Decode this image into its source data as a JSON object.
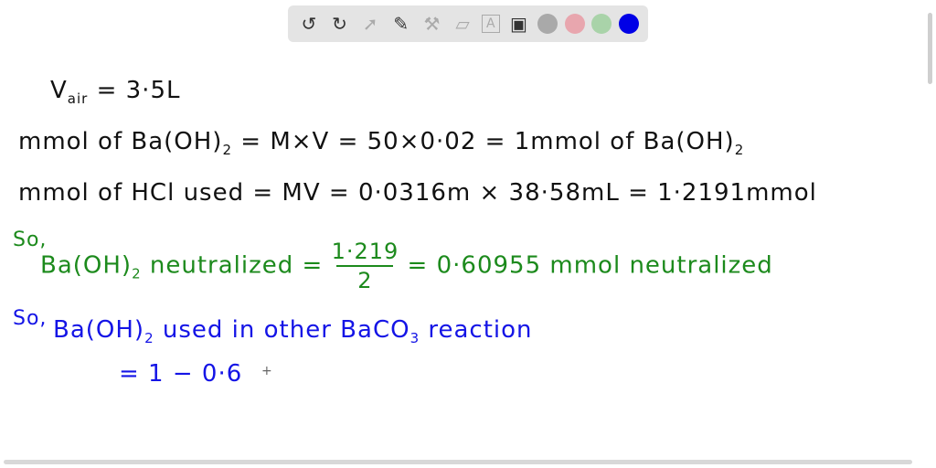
{
  "toolbar": {
    "tools": [
      {
        "icon": "undo-icon",
        "glyph": "↺"
      },
      {
        "icon": "redo-icon",
        "glyph": "↻"
      },
      {
        "icon": "select-cursor-icon",
        "glyph": "➚"
      },
      {
        "icon": "pencil-icon",
        "glyph": "✎"
      },
      {
        "icon": "tools-icon",
        "glyph": "⚒"
      },
      {
        "icon": "eraser-icon",
        "glyph": "▱"
      },
      {
        "icon": "text-box-icon",
        "glyph": "A"
      },
      {
        "icon": "image-icon",
        "glyph": "▣"
      }
    ],
    "colors": [
      "#a9a9a9",
      "#e8a6ae",
      "#a9d3a9",
      "#0000e6"
    ]
  },
  "notes": {
    "line1": {
      "lhs": "V",
      "sub": "air",
      "rhs": " = 3·5L"
    },
    "line2": {
      "a": "mmol of Ba(OH)",
      "sub1": "2",
      "b": " = M×V = 50×0·02 = 1mmol of Ba(OH)",
      "sub2": "2"
    },
    "line3": "mmol of HCl used = MV = 0·0316m × 38·58mL = 1·2191mmol",
    "line4": {
      "so": "So,",
      "a": "Ba(OH)",
      "sub": "2",
      "b": " neutralized = ",
      "num": "1·219",
      "den": "2",
      "c": " = 0·60955 mmol neutralized"
    },
    "line5": {
      "so": "So,",
      "a": "Ba(OH)",
      "sub": "2",
      "b": " used in other BaCO",
      "sub2": "3",
      "c": " reaction"
    },
    "line6": "= 1 − 0·6",
    "cursor": "+"
  }
}
